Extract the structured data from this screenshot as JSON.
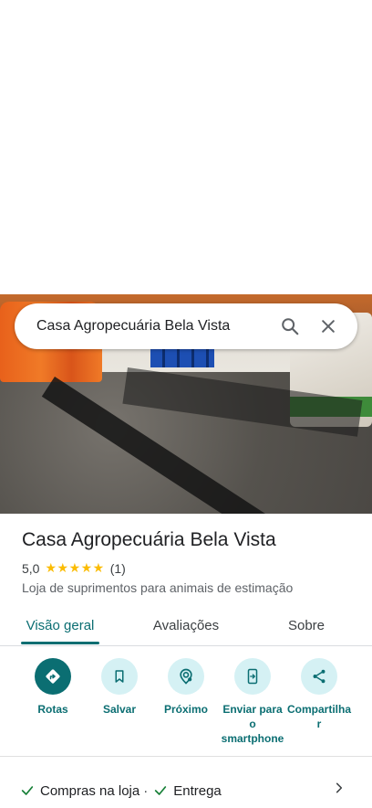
{
  "search": {
    "query": "Casa Agropecuária Bela Vista"
  },
  "place": {
    "name": "Casa Agropecuária Bela Vista",
    "rating": "5,0",
    "stars": "★★★★★",
    "review_count": "(1)",
    "category": "Loja de suprimentos para animais de estimação"
  },
  "tabs": [
    {
      "label": "Visão geral",
      "active": true
    },
    {
      "label": "Avaliações",
      "active": false
    },
    {
      "label": "Sobre",
      "active": false
    }
  ],
  "actions": [
    {
      "label": "Rotas",
      "icon": "directions-icon"
    },
    {
      "label": "Salvar",
      "icon": "bookmark-icon"
    },
    {
      "label": "Próximo",
      "icon": "nearby-icon"
    },
    {
      "label": "Enviar para o smartphone",
      "icon": "send-to-phone-icon"
    },
    {
      "label": "Compartilhar",
      "icon": "share-icon"
    }
  ],
  "features": {
    "item1": "Compras na loja",
    "separator": "·",
    "item2": "Entrega"
  },
  "colors": {
    "accent": "#0b6e72",
    "accent_light": "#d5f1f4",
    "star": "#fbbc04",
    "check": "#188038"
  }
}
